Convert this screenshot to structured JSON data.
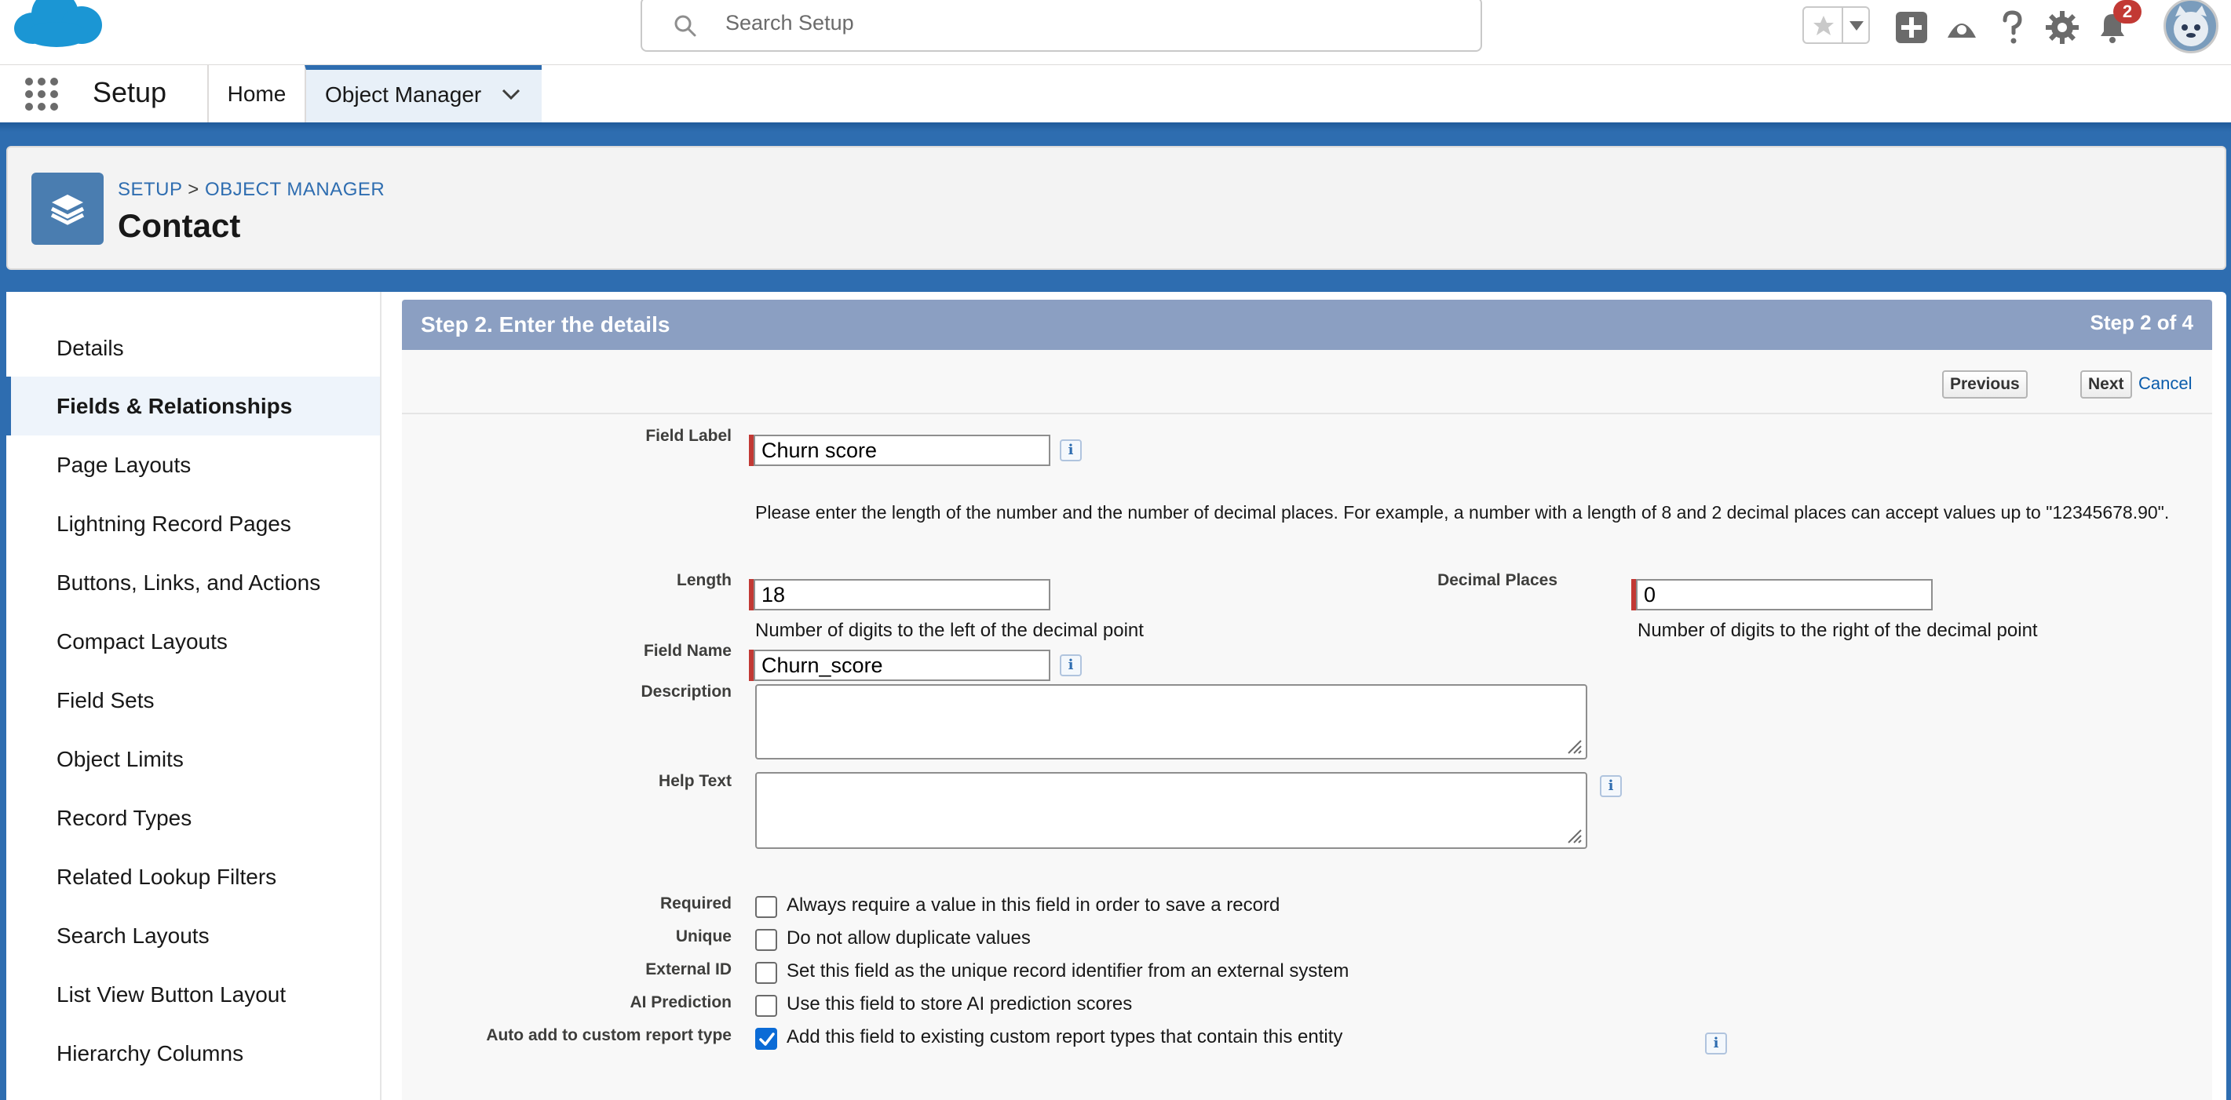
{
  "header": {
    "search_placeholder": "Search Setup",
    "notification_count": "2"
  },
  "nav": {
    "app_name": "Setup",
    "tabs": [
      {
        "label": "Home"
      },
      {
        "label": "Object Manager"
      }
    ]
  },
  "page_header": {
    "breadcrumb": {
      "setup": "SETUP",
      "separator": ">",
      "object_manager": "OBJECT MANAGER"
    },
    "title": "Contact"
  },
  "sidebar": {
    "items": [
      {
        "label": "Details"
      },
      {
        "label": "Fields & Relationships"
      },
      {
        "label": "Page Layouts"
      },
      {
        "label": "Lightning Record Pages"
      },
      {
        "label": "Buttons, Links, and Actions"
      },
      {
        "label": "Compact Layouts"
      },
      {
        "label": "Field Sets"
      },
      {
        "label": "Object Limits"
      },
      {
        "label": "Record Types"
      },
      {
        "label": "Related Lookup Filters"
      },
      {
        "label": "Search Layouts"
      },
      {
        "label": "List View Button Layout"
      },
      {
        "label": "Hierarchy Columns"
      }
    ]
  },
  "form": {
    "step_title": "Step 2. Enter the details",
    "step_count": "Step 2 of 4",
    "buttons": {
      "previous": "Previous",
      "next": "Next",
      "cancel": "Cancel"
    },
    "field_label": {
      "label": "Field Label",
      "value": "Churn score"
    },
    "instructions": "Please enter the length of the number and the number of decimal places. For example, a number with a length of 8 and 2 decimal places can accept values up to \"12345678.90\".",
    "length": {
      "label": "Length",
      "value": "18",
      "hint": "Number of digits to the left of the decimal point"
    },
    "decimal_places": {
      "label": "Decimal Places",
      "value": "0",
      "hint": "Number of digits to the right of the decimal point"
    },
    "field_name": {
      "label": "Field Name",
      "value": "Churn_score"
    },
    "description": {
      "label": "Description",
      "value": ""
    },
    "help_text": {
      "label": "Help Text",
      "value": ""
    },
    "info_glyph": "i",
    "checkboxes": [
      {
        "label": "Required",
        "text": "Always require a value in this field in order to save a record",
        "checked": false
      },
      {
        "label": "Unique",
        "text": "Do not allow duplicate values",
        "checked": false
      },
      {
        "label": "External ID",
        "text": "Set this field as the unique record identifier from an external system",
        "checked": false
      },
      {
        "label": "AI Prediction",
        "text": "Use this field to store AI prediction scores",
        "checked": false
      },
      {
        "label": "Auto add to custom report type",
        "text": "Add this field to existing custom report types that contain this entity",
        "checked": true
      }
    ]
  },
  "colors": {
    "brand_blue": "#2e6db0",
    "step_bar": "#8b9fc2",
    "required": "#c23934",
    "checkbox_checked": "#0b6bd6"
  },
  "icons": [
    "salesforce-cloud-logo",
    "search-icon",
    "star-icon",
    "chevron-down-icon",
    "add-icon",
    "trailhead-icon",
    "help-icon",
    "gear-icon",
    "bell-icon",
    "avatar",
    "app-launcher-icon",
    "layers-icon",
    "info-icon",
    "resize-grip-icon",
    "checkmark-icon"
  ]
}
